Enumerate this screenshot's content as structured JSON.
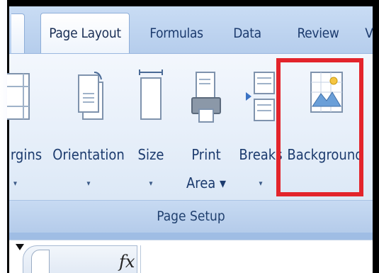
{
  "tabs": [
    {
      "label": "Page Layout",
      "active": true
    },
    {
      "label": "Formulas",
      "active": false
    },
    {
      "label": "Data",
      "active": false
    },
    {
      "label": "Review",
      "active": false
    },
    {
      "label": "V",
      "active": false
    }
  ],
  "buttons": {
    "margins": {
      "label": "rgins",
      "dropdown": "▾"
    },
    "orientation": {
      "label": "Orientation",
      "dropdown": "▾"
    },
    "size": {
      "label": "Size",
      "dropdown": "▾"
    },
    "print_area": {
      "label_line1": "Print",
      "label_line2": "Area ▾"
    },
    "breaks": {
      "label": "Breaks",
      "dropdown": "▾"
    },
    "background": {
      "label": "Background"
    }
  },
  "group_label": "Page Setup",
  "formula_bar": {
    "fx_label": "fx"
  },
  "colors": {
    "highlight": "#e3242b",
    "tab_text": "#1c3b6e",
    "ribbon_top": "#f3f7fd",
    "ribbon_bottom": "#d4e3f4"
  }
}
